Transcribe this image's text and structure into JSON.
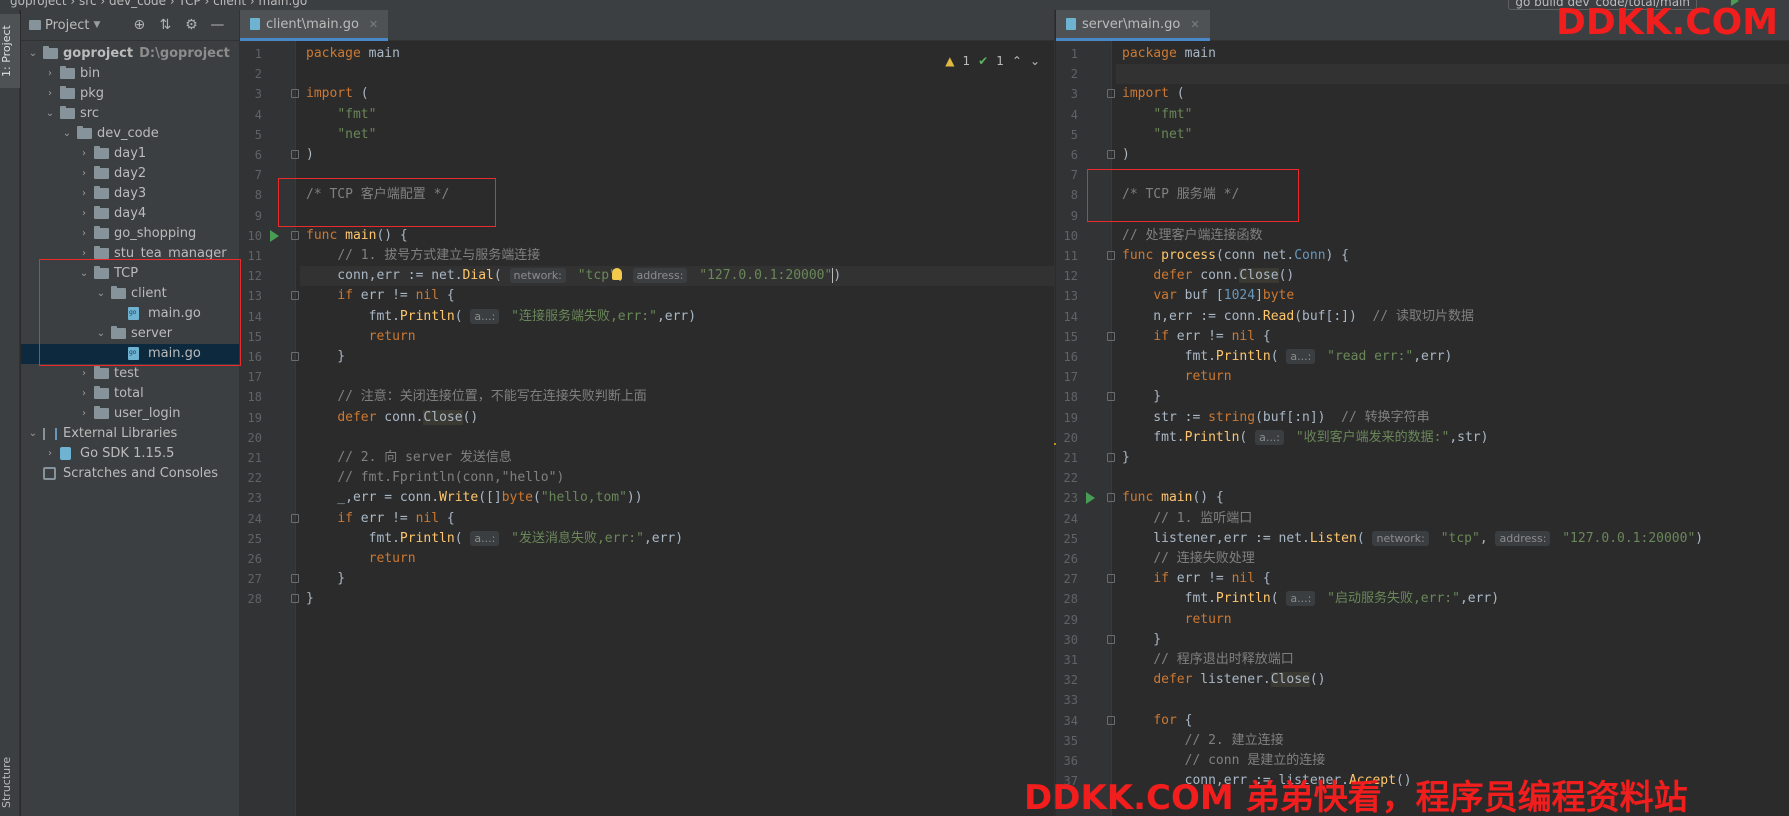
{
  "window": {
    "breadcrumb": "goproject › src › dev_code › TCP › client › main.go",
    "run_config": "go build dev_code/total/main"
  },
  "tool_stripe": {
    "project_tab": "1: Project",
    "structure_tab": "Structure"
  },
  "project_panel": {
    "title": "Project",
    "tree": [
      {
        "label": "goproject",
        "path": "D:\\goproject",
        "depth": 0,
        "icon": "folder-icon",
        "expanded": true,
        "bold": true
      },
      {
        "label": "bin",
        "depth": 1,
        "icon": "folder-icon",
        "expanded": false
      },
      {
        "label": "pkg",
        "depth": 1,
        "icon": "folder-icon",
        "expanded": false
      },
      {
        "label": "src",
        "depth": 1,
        "icon": "folder-icon",
        "expanded": true
      },
      {
        "label": "dev_code",
        "depth": 2,
        "icon": "folder-icon",
        "expanded": true
      },
      {
        "label": "day1",
        "depth": 3,
        "icon": "folder-icon",
        "expanded": false
      },
      {
        "label": "day2",
        "depth": 3,
        "icon": "folder-icon",
        "expanded": false
      },
      {
        "label": "day3",
        "depth": 3,
        "icon": "folder-icon",
        "expanded": false
      },
      {
        "label": "day4",
        "depth": 3,
        "icon": "folder-icon",
        "expanded": false
      },
      {
        "label": "go_shopping",
        "depth": 3,
        "icon": "folder-icon",
        "expanded": false
      },
      {
        "label": "stu_tea_manager",
        "depth": 3,
        "icon": "folder-icon",
        "expanded": false
      },
      {
        "label": "TCP",
        "depth": 3,
        "icon": "folder-icon",
        "expanded": true
      },
      {
        "label": "client",
        "depth": 4,
        "icon": "folder-icon",
        "expanded": true
      },
      {
        "label": "main.go",
        "depth": 5,
        "icon": "go-file-icon",
        "leaf": true
      },
      {
        "label": "server",
        "depth": 4,
        "icon": "folder-icon",
        "expanded": true
      },
      {
        "label": "main.go",
        "depth": 5,
        "icon": "go-file-icon",
        "leaf": true,
        "selected": true
      },
      {
        "label": "test",
        "depth": 3,
        "icon": "folder-icon",
        "expanded": false
      },
      {
        "label": "total",
        "depth": 3,
        "icon": "folder-icon",
        "expanded": false
      },
      {
        "label": "user_login",
        "depth": 3,
        "icon": "folder-icon",
        "expanded": false
      },
      {
        "label": "External Libraries",
        "depth": 0,
        "icon": "libraries-icon",
        "expanded": true
      },
      {
        "label": "Go SDK 1.15.5",
        "depth": 1,
        "icon": "sdk-icon",
        "expanded": false
      },
      {
        "label": "Scratches and Consoles",
        "depth": 0,
        "icon": "scratches-icon",
        "leaf": true
      }
    ]
  },
  "client_editor": {
    "tab": "client\\main.go",
    "inspections": {
      "warnings": "1",
      "ok": "1"
    },
    "current_line": 12,
    "lines": [
      [
        [
          "package",
          "k"
        ],
        [
          " main",
          ""
        ]
      ],
      [],
      [
        [
          "import",
          "k"
        ],
        [
          " (",
          ""
        ]
      ],
      [
        [
          "    ",
          ""
        ],
        [
          "\"fmt\"",
          "s"
        ]
      ],
      [
        [
          "    ",
          ""
        ],
        [
          "\"net\"",
          "s"
        ]
      ],
      [
        [
          ")",
          ""
        ]
      ],
      [],
      [
        [
          "/* TCP 客户端配置 */",
          "c"
        ]
      ],
      [],
      [
        [
          "func",
          "k"
        ],
        [
          " ",
          ""
        ],
        [
          "main",
          "f"
        ],
        [
          "() {",
          ""
        ]
      ],
      [
        [
          "    ",
          ""
        ],
        [
          "// 1. 拔号方式建立与服务端连接",
          "c"
        ]
      ],
      [
        [
          "    conn,err := net.",
          ""
        ],
        [
          "Dial",
          "f"
        ],
        [
          "( ",
          ""
        ],
        [
          "network:",
          "h"
        ],
        [
          " ",
          ""
        ],
        [
          "\"tcp\"",
          "s"
        ],
        [
          ", ",
          ""
        ],
        [
          "address:",
          "h"
        ],
        [
          " ",
          ""
        ],
        [
          "\"127.0.0.1:20000\"",
          "s"
        ],
        [
          "|",
          "caret"
        ],
        [
          ")",
          ""
        ]
      ],
      [
        [
          "    ",
          ""
        ],
        [
          "if",
          "k"
        ],
        [
          " err != ",
          ""
        ],
        [
          "nil",
          "k"
        ],
        [
          " {",
          ""
        ]
      ],
      [
        [
          "        fmt.",
          ""
        ],
        [
          "Println",
          "f"
        ],
        [
          "( ",
          ""
        ],
        [
          "a...:",
          "h"
        ],
        [
          " ",
          ""
        ],
        [
          "\"连接服务端失败,err:\"",
          "s"
        ],
        [
          ",err)",
          ""
        ]
      ],
      [
        [
          "        ",
          ""
        ],
        [
          "return",
          "k"
        ]
      ],
      [
        [
          "    }",
          ""
        ]
      ],
      [],
      [
        [
          "    ",
          ""
        ],
        [
          "// 注意：关闭连接位置，不能写在连接失败判断上面",
          "c"
        ]
      ],
      [
        [
          "    ",
          ""
        ],
        [
          "defer",
          "k"
        ],
        [
          " conn.",
          ""
        ],
        [
          "Close",
          "x"
        ],
        [
          "()",
          ""
        ]
      ],
      [],
      [
        [
          "    ",
          ""
        ],
        [
          "// 2. 向 server 发送信息",
          "c"
        ]
      ],
      [
        [
          "    ",
          ""
        ],
        [
          "// fmt.Fprintln(conn,\"hello\")",
          "c"
        ]
      ],
      [
        [
          "    _,err = conn.",
          ""
        ],
        [
          "Write",
          "f"
        ],
        [
          "([]",
          ""
        ],
        [
          "byte",
          "k"
        ],
        [
          "(",
          ""
        ],
        [
          "\"hello,tom\"",
          "s"
        ],
        [
          "))",
          ""
        ]
      ],
      [
        [
          "    ",
          ""
        ],
        [
          "if",
          "k"
        ],
        [
          " err != ",
          ""
        ],
        [
          "nil",
          "k"
        ],
        [
          " {",
          ""
        ]
      ],
      [
        [
          "        fmt.",
          ""
        ],
        [
          "Println",
          "f"
        ],
        [
          "( ",
          ""
        ],
        [
          "a...:",
          "h"
        ],
        [
          " ",
          ""
        ],
        [
          "\"发送消息失败,err:\"",
          "s"
        ],
        [
          ",err)",
          ""
        ]
      ],
      [
        [
          "        ",
          ""
        ],
        [
          "return",
          "k"
        ]
      ],
      [
        [
          "    }",
          ""
        ]
      ],
      [
        [
          "}",
          ""
        ]
      ]
    ]
  },
  "server_editor": {
    "tab": "server\\main.go",
    "current_line": 2,
    "lines": [
      [
        [
          "package",
          "k"
        ],
        [
          " main",
          ""
        ]
      ],
      [],
      [
        [
          "import",
          "k"
        ],
        [
          " (",
          ""
        ]
      ],
      [
        [
          "    ",
          ""
        ],
        [
          "\"fmt\"",
          "s"
        ]
      ],
      [
        [
          "    ",
          ""
        ],
        [
          "\"net\"",
          "s"
        ]
      ],
      [
        [
          ")",
          ""
        ]
      ],
      [],
      [
        [
          "/* TCP 服务端 */",
          "c"
        ]
      ],
      [],
      [
        [
          "// 处理客户端连接函数",
          "c"
        ]
      ],
      [
        [
          "func",
          "k"
        ],
        [
          " ",
          ""
        ],
        [
          "process",
          "f"
        ],
        [
          "(conn net.",
          ""
        ],
        [
          "Conn",
          "t"
        ],
        [
          ") {",
          ""
        ]
      ],
      [
        [
          "    ",
          ""
        ],
        [
          "defer",
          "k"
        ],
        [
          " conn.",
          ""
        ],
        [
          "Close",
          "x"
        ],
        [
          "()",
          ""
        ]
      ],
      [
        [
          "    ",
          ""
        ],
        [
          "var",
          "k"
        ],
        [
          " buf [",
          ""
        ],
        [
          "1024",
          "n"
        ],
        [
          "]",
          ""
        ],
        [
          "byte",
          "k"
        ]
      ],
      [
        [
          "    n,err := conn.",
          ""
        ],
        [
          "Read",
          "f"
        ],
        [
          "(buf[:])  ",
          ""
        ],
        [
          "// 读取切片数据",
          "c"
        ]
      ],
      [
        [
          "    ",
          ""
        ],
        [
          "if",
          "k"
        ],
        [
          " err != ",
          ""
        ],
        [
          "nil",
          "k"
        ],
        [
          " {",
          ""
        ]
      ],
      [
        [
          "        fmt.",
          ""
        ],
        [
          "Println",
          "f"
        ],
        [
          "( ",
          ""
        ],
        [
          "a...:",
          "h"
        ],
        [
          " ",
          ""
        ],
        [
          "\"read err:\"",
          "s"
        ],
        [
          ",err)",
          ""
        ]
      ],
      [
        [
          "        ",
          ""
        ],
        [
          "return",
          "k"
        ]
      ],
      [
        [
          "    }",
          ""
        ]
      ],
      [
        [
          "    str := ",
          ""
        ],
        [
          "string",
          "k"
        ],
        [
          "(buf[:n])  ",
          ""
        ],
        [
          "// 转换字符串",
          "c"
        ]
      ],
      [
        [
          "    fmt.",
          ""
        ],
        [
          "Println",
          "f"
        ],
        [
          "( ",
          ""
        ],
        [
          "a...:",
          "h"
        ],
        [
          " ",
          ""
        ],
        [
          "\"收到客户端发来的数据:\"",
          "s"
        ],
        [
          ",str)",
          ""
        ]
      ],
      [
        [
          "}",
          ""
        ]
      ],
      [],
      [
        [
          "func",
          "k"
        ],
        [
          " ",
          ""
        ],
        [
          "main",
          "f"
        ],
        [
          "() {",
          ""
        ]
      ],
      [
        [
          "    ",
          ""
        ],
        [
          "// 1. 监听端口",
          "c"
        ]
      ],
      [
        [
          "    listener,err := net.",
          ""
        ],
        [
          "Listen",
          "f"
        ],
        [
          "( ",
          ""
        ],
        [
          "network:",
          "h"
        ],
        [
          " ",
          ""
        ],
        [
          "\"tcp\"",
          "s"
        ],
        [
          ", ",
          ""
        ],
        [
          "address:",
          "h"
        ],
        [
          " ",
          ""
        ],
        [
          "\"127.0.0.1:20000\"",
          "s"
        ],
        [
          ")",
          ""
        ]
      ],
      [
        [
          "    ",
          ""
        ],
        [
          "// 连接失败处理",
          "c"
        ]
      ],
      [
        [
          "    ",
          ""
        ],
        [
          "if",
          "k"
        ],
        [
          " err != ",
          ""
        ],
        [
          "nil",
          "k"
        ],
        [
          " {",
          ""
        ]
      ],
      [
        [
          "        fmt.",
          ""
        ],
        [
          "Println",
          "f"
        ],
        [
          "( ",
          ""
        ],
        [
          "a...:",
          "h"
        ],
        [
          " ",
          ""
        ],
        [
          "\"启动服务失败,err:\"",
          "s"
        ],
        [
          ",err)",
          ""
        ]
      ],
      [
        [
          "        ",
          ""
        ],
        [
          "return",
          "k"
        ]
      ],
      [
        [
          "    }",
          ""
        ]
      ],
      [
        [
          "    ",
          ""
        ],
        [
          "// 程序退出时释放端口",
          "c"
        ]
      ],
      [
        [
          "    ",
          ""
        ],
        [
          "defer",
          "k"
        ],
        [
          " listener.",
          ""
        ],
        [
          "Close",
          "x"
        ],
        [
          "()",
          ""
        ]
      ],
      [],
      [
        [
          "    ",
          ""
        ],
        [
          "for",
          "k"
        ],
        [
          " {",
          ""
        ]
      ],
      [
        [
          "        ",
          ""
        ],
        [
          "// 2. 建立连接",
          "c"
        ]
      ],
      [
        [
          "        ",
          ""
        ],
        [
          "// conn 是建立的连接",
          "c"
        ]
      ],
      [
        [
          "        conn,err := listener.",
          ""
        ],
        [
          "Accept",
          "f"
        ],
        [
          "()",
          ""
        ]
      ]
    ]
  },
  "watermarks": {
    "top": "DDKK.COM",
    "bottom": "DDKK.COM 弟弟快看，程序员编程资料站"
  },
  "colors": {
    "keyword": "#cc7832",
    "string": "#6a8759",
    "comment": "#808080",
    "function": "#ffc66d",
    "type": "#6897bb",
    "watermark": "#f21d1d",
    "highlight_box": "#ea2b2b"
  }
}
